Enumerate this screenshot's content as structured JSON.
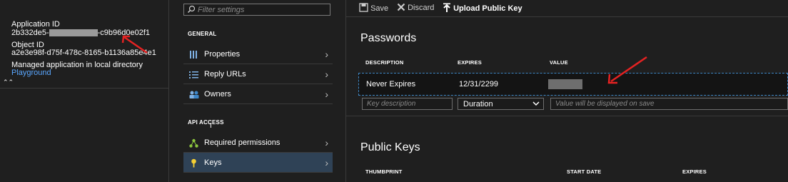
{
  "app": {
    "application_id_label": "Application ID",
    "application_id_prefix": "2b332de5-",
    "application_id_suffix": "-c9b96d0e02f1",
    "object_id_label": "Object ID",
    "object_id_value": "a2e3e98f-d75f-478c-8165-b1136a85e4e1",
    "managed_label": "Managed application in local directory",
    "managed_link": "Playground",
    "collapse_glyph": "⌃⌃"
  },
  "menu": {
    "filter_placeholder": "Filter settings",
    "sections": [
      {
        "title": "GENERAL",
        "items": [
          {
            "label": "Properties",
            "icon": "properties-icon"
          },
          {
            "label": "Reply URLs",
            "icon": "list-icon"
          },
          {
            "label": "Owners",
            "icon": "owners-icon"
          }
        ]
      },
      {
        "title": "API ACCESS",
        "items": [
          {
            "label": "Required permissions",
            "icon": "permissions-icon"
          },
          {
            "label": "Keys",
            "icon": "key-icon",
            "selected": true
          }
        ]
      }
    ]
  },
  "toolbar": {
    "save_label": "Save",
    "discard_label": "Discard",
    "upload_label": "Upload Public Key"
  },
  "passwords": {
    "title": "Passwords",
    "columns": [
      "DESCRIPTION",
      "EXPIRES",
      "VALUE"
    ],
    "row": {
      "description": "Never Expires",
      "expires": "12/31/2299"
    },
    "new_row": {
      "description_placeholder": "Key description",
      "duration_value": "Duration",
      "value_placeholder": "Value will be displayed on save"
    }
  },
  "public_keys": {
    "title": "Public Keys",
    "columns": [
      "THUMBPRINT",
      "START DATE",
      "EXPIRES"
    ]
  },
  "colors": {
    "background": "#1f1f1f",
    "selected_item": "#2f4256",
    "link": "#5aa7ff",
    "row_border": "#3f88c6",
    "arrow": "#e52222"
  }
}
